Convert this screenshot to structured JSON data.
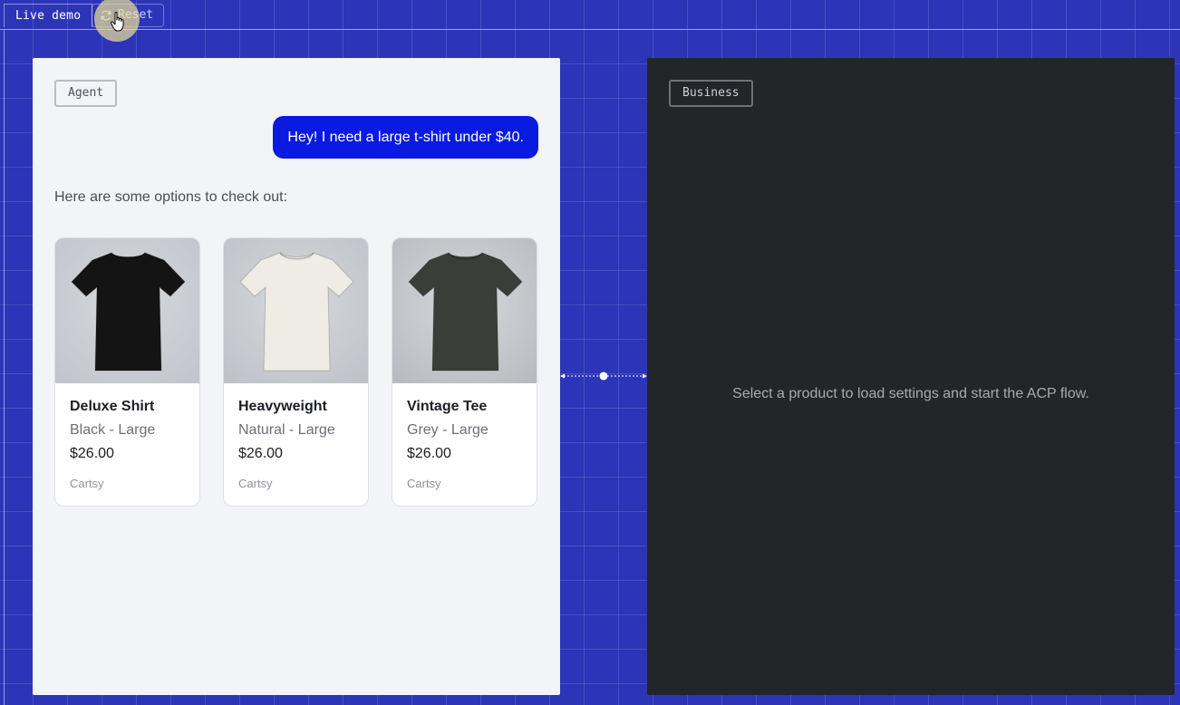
{
  "topbar": {
    "live_demo_label": "Live demo",
    "reset_label": "Reset"
  },
  "agent": {
    "tag": "Agent",
    "user_message": "Hey! I need a large t-shirt under $40.",
    "assistant_message": "Here are some options to check out:",
    "products": [
      {
        "name": "Deluxe Shirt",
        "variant": "Black - Large",
        "price": "$26.00",
        "merchant": "Cartsy",
        "shirt_color": "#141414",
        "bg_color": "#c2c5cc"
      },
      {
        "name": "Heavyweight",
        "variant": "Natural - Large",
        "price": "$26.00",
        "merchant": "Cartsy",
        "shirt_color": "#eeece4",
        "bg_color": "#bfc2c8"
      },
      {
        "name": "Vintage Tee",
        "variant": "Grey - Large",
        "price": "$26.00",
        "merchant": "Cartsy",
        "shirt_color": "#3a3d38",
        "bg_color": "#b8bbc0"
      }
    ]
  },
  "business": {
    "tag": "Business",
    "empty_message": "Select a product to load settings and start the ACP flow."
  },
  "colors": {
    "background": "#2c35b8",
    "user_bubble": "#0a1ae0",
    "agent_panel": "#f2f4f8",
    "business_panel": "#232629"
  }
}
